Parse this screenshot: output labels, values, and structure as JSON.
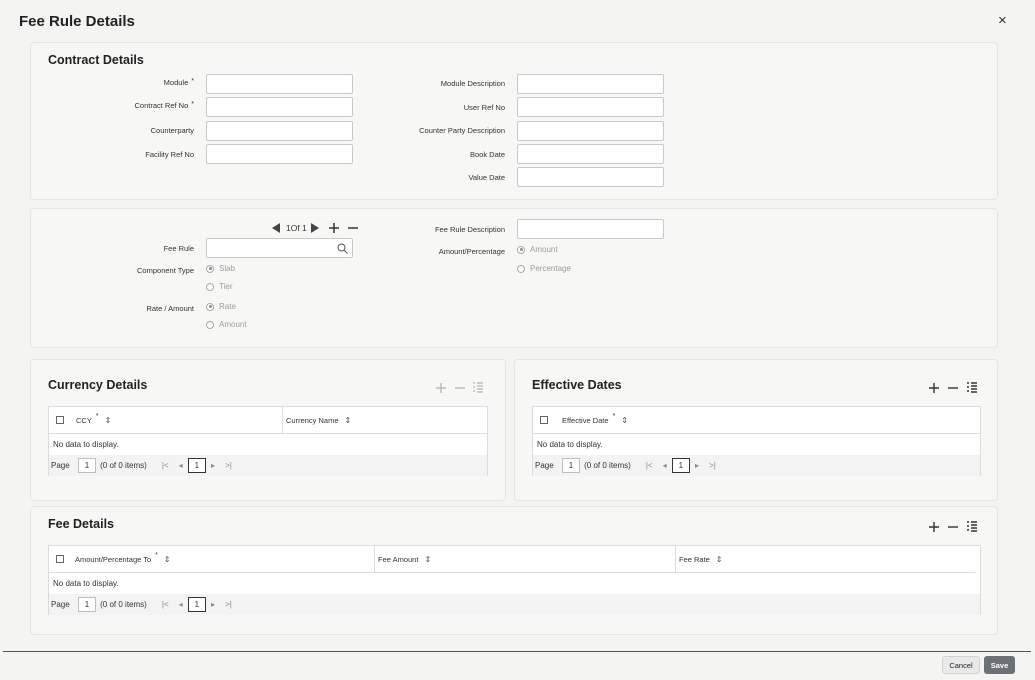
{
  "title": "Fee Rule Details",
  "close_icon": "×",
  "contract": {
    "title": "Contract Details",
    "module_label": "Module",
    "contract_ref_label": "Contract Ref No",
    "counterparty_label": "Counterparty",
    "facility_ref_label": "Facility Ref No",
    "module_desc_label": "Module Description",
    "user_ref_label": "User Ref No",
    "cp_desc_label": "Counter Party Description",
    "book_date_label": "Book Date",
    "value_date_label": "Value Date",
    "required_mark": "*"
  },
  "fee_rule": {
    "record_nav": "1Of 1",
    "fee_rule_label": "Fee Rule",
    "component_type_label": "Component Type",
    "slab": "Slab",
    "tier": "Tier",
    "rate_amount_label": "Rate / Amount",
    "rate": "Rate",
    "amount": "Amount",
    "fee_rule_desc_label": "Fee Rule Description",
    "amount_percentage_label": "Amount/Percentage",
    "amount_opt": "Amount",
    "percentage_opt": "Percentage"
  },
  "currency": {
    "title": "Currency Details",
    "col_ccy": "CCY",
    "col_name": "Currency Name"
  },
  "effective": {
    "title": "Effective Dates",
    "col_date": "Effective Date"
  },
  "fee": {
    "title": "Fee Details",
    "col_amt_pct": "Amount/Percentage To",
    "col_fee_amount": "Fee Amount",
    "col_fee_rate": "Fee Rate"
  },
  "table": {
    "no_data": "No data to display.",
    "page_label": "Page",
    "page_value": "1",
    "items_text": "(0 of 0 items)",
    "current_page": "1",
    "required_mark": "*"
  },
  "footer": {
    "cancel": "Cancel",
    "save": "Save"
  },
  "icons": {
    "add": "add-icon",
    "remove": "remove-icon",
    "list": "list-icon",
    "search": "search-icon",
    "sort": "sort-icon",
    "first": "first-page-icon",
    "prev": "prev-page-icon",
    "next": "next-page-icon",
    "last": "last-page-icon"
  }
}
